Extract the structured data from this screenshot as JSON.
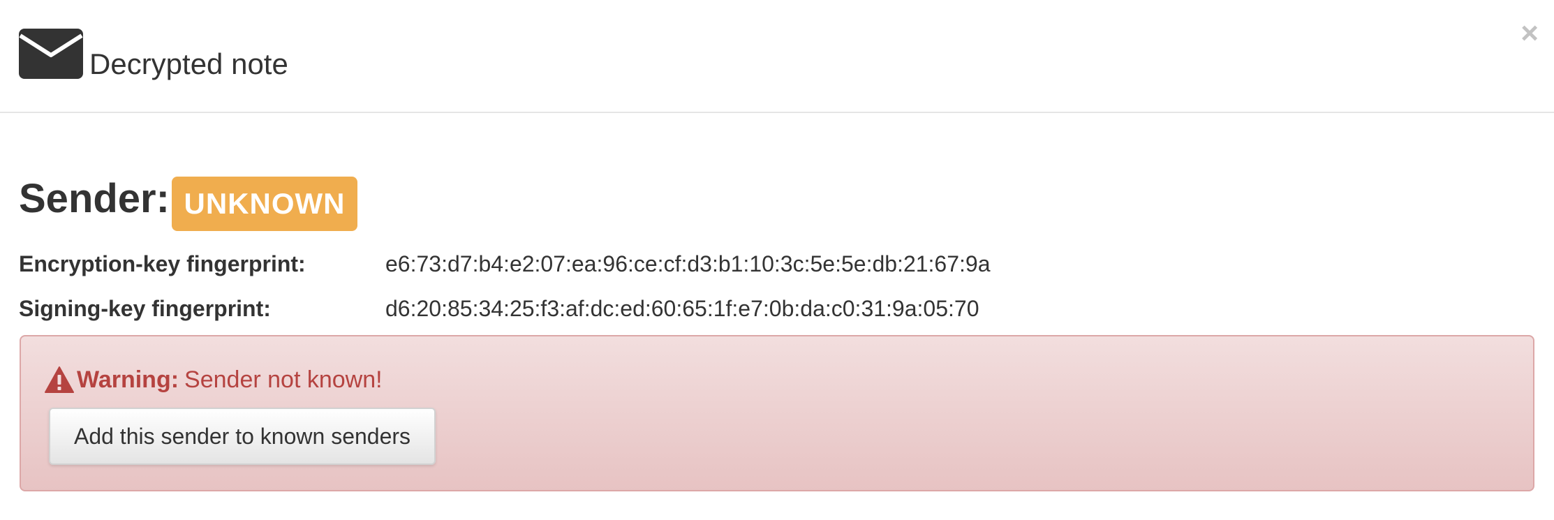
{
  "header": {
    "icon": "envelope-icon",
    "title": "Decrypted note",
    "close_label": "×"
  },
  "sender": {
    "heading": "Sender:",
    "status": "UNKNOWN",
    "status_color": "#f0ad4e"
  },
  "fingerprints": {
    "encryption": {
      "label": "Encryption-key fingerprint:",
      "value": "e6:73:d7:b4:e2:07:ea:96:ce:cf:d3:b1:10:3c:5e:5e:db:21:67:9a"
    },
    "signing": {
      "label": "Signing-key fingerprint:",
      "value": "d6:20:85:34:25:f3:af:dc:ed:60:65:1f:e7:0b:da:c0:31:9a:05:70"
    }
  },
  "alert": {
    "icon": "warning-triangle-icon",
    "label": "Warning:",
    "message": "Sender not known!",
    "button_label": "Add this sender to known senders",
    "text_color": "#b54340",
    "background_color": "#f2dede"
  }
}
